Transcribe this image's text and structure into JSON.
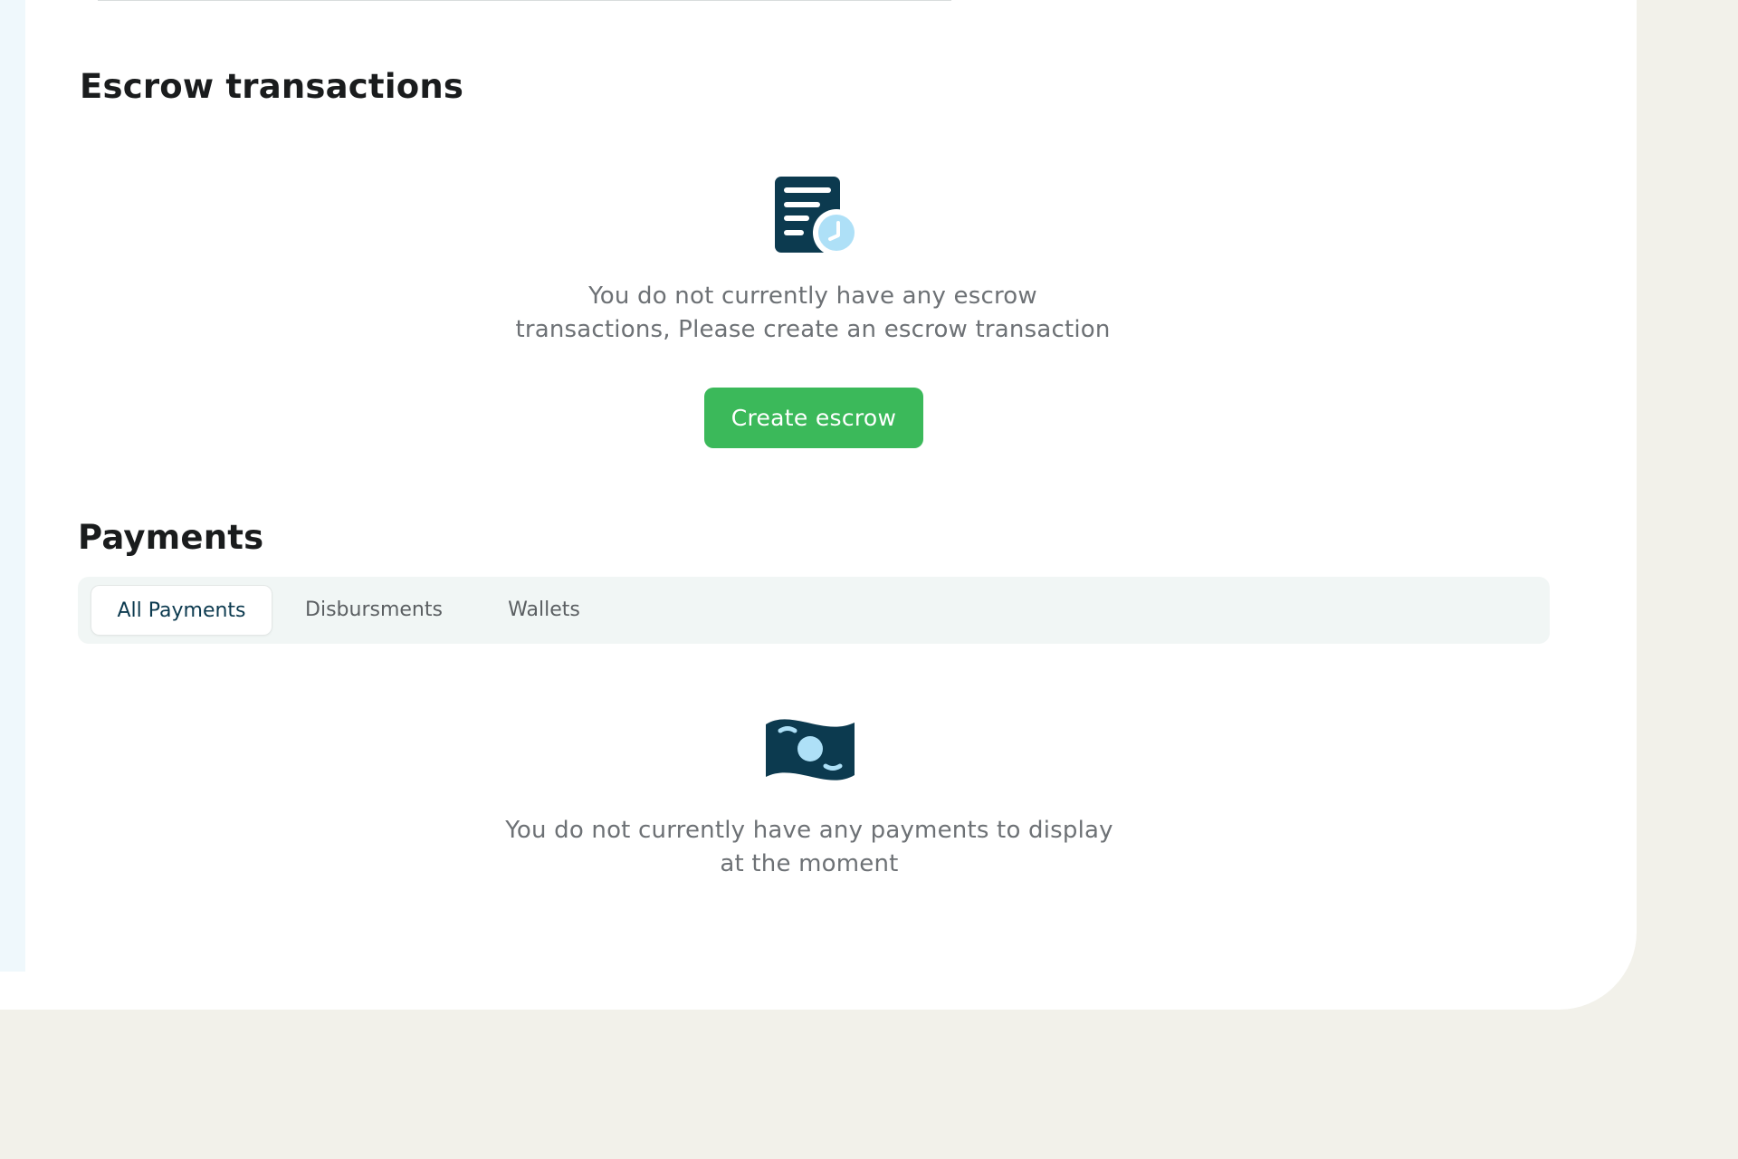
{
  "escrow": {
    "title": "Escrow transactions",
    "icon": "document-clock-icon",
    "empty_line1": "You do not currently have any escrow",
    "empty_line2": "transactions, Please create an escrow transaction",
    "create_button": "Create escrow"
  },
  "payments": {
    "title": "Payments",
    "tabs": [
      {
        "label": "All Payments",
        "active": true
      },
      {
        "label": "Disbursments",
        "active": false
      },
      {
        "label": "Wallets",
        "active": false
      }
    ],
    "icon": "banknote-icon",
    "empty_line1": "You do not currently have any payments to display",
    "empty_line2": "at the moment"
  },
  "colors": {
    "primary_green": "#3bb95a",
    "icon_navy": "#0c3a4f",
    "icon_accent": "#aee0f7",
    "page_background": "#f2f1ea",
    "tabs_background": "#f1f6f5"
  }
}
